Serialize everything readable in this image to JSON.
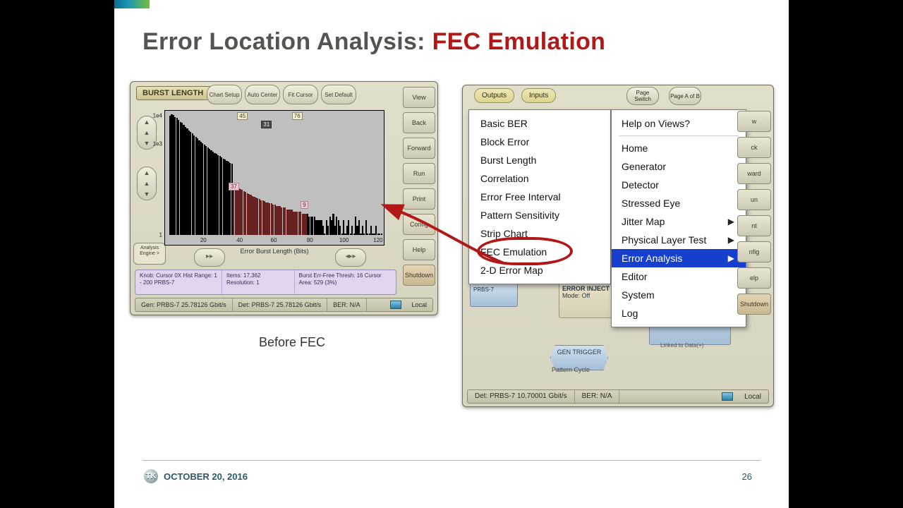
{
  "title": {
    "plain": "Error Location Analysis: ",
    "em": "FEC Emulation"
  },
  "footer": {
    "date": "OCTOBER 20, 2016",
    "page": "26",
    "logo": "TK"
  },
  "left_caption": "Before FEC",
  "chart_data": {
    "type": "bar",
    "title": "BURST LENGTH",
    "xlabel": "Error Burst Length (Bits)",
    "ylabel": "",
    "x_ticks": [
      20,
      40,
      60,
      80,
      100,
      120
    ],
    "y_scale": "log",
    "ylim": [
      1,
      10000
    ],
    "y_ticks": [
      "1",
      "1e3",
      "1e4"
    ],
    "highlight_range": [
      38,
      80
    ],
    "markers": [
      {
        "x": 45,
        "label": "45"
      },
      {
        "x": 76,
        "label": "76"
      },
      {
        "x_mid": 60,
        "label": "31"
      },
      {
        "x": 38,
        "y": 45,
        "label": "37",
        "style": "pink"
      },
      {
        "x": 80,
        "y": 6,
        "label": "9",
        "style": "pink"
      }
    ],
    "values": [
      8500,
      9400,
      8800,
      7600,
      7200,
      6200,
      5400,
      5000,
      4300,
      3700,
      3200,
      2800,
      2500,
      2200,
      1900,
      1700,
      1500,
      1300,
      1200,
      1050,
      950,
      850,
      760,
      690,
      620,
      560,
      510,
      470,
      430,
      400,
      360,
      330,
      300,
      280,
      260,
      240,
      220,
      45,
      40,
      37,
      34,
      32,
      30,
      27,
      26,
      24,
      22,
      21,
      19,
      18,
      17,
      16,
      15,
      14,
      14,
      13,
      12,
      12,
      11,
      11,
      10,
      10,
      9,
      9,
      9,
      8,
      8,
      8,
      7,
      7,
      7,
      7,
      6,
      6,
      6,
      6,
      6,
      5,
      5,
      5,
      5,
      4,
      4,
      4,
      4,
      3,
      3,
      3,
      3,
      2,
      1,
      3,
      2,
      4,
      3,
      5,
      2,
      4,
      3,
      2,
      1,
      3,
      1,
      2,
      3,
      1,
      2,
      1,
      4,
      2,
      3,
      1,
      2,
      1,
      3,
      1,
      1,
      2,
      1,
      1,
      2,
      1,
      1,
      1
    ]
  },
  "left_buttons": {
    "chart_setup": "Chart\nSetup",
    "auto_center": "Auto\nCenter",
    "fit_cursor": "Fit\nCursor",
    "set_default": "Set\nDefault"
  },
  "left_analysis_btn": "Analysis\nEngine >",
  "left_sidebar": [
    "View",
    "Back",
    "Forward",
    "Run",
    "Print",
    "Config",
    "Help",
    "Shutdown"
  ],
  "left_status": {
    "c1": "Knob: Cursor 0X\nHist Range: 1 - 200\nPRBS-7",
    "c2": "Items: 17,362\nResolution: 1",
    "c3": "Burst Err-Free Thresh: 16\nCursor Area: 529 (3%)"
  },
  "left_bottom": {
    "gen": "Gen: PRBS-7 25.78126 Gbit/s",
    "det": "Det: PRBS-7 25.78126 Gbit/s",
    "ber": "BER: N/A",
    "local": "Local"
  },
  "right_tabs": [
    "Outputs",
    "Inputs"
  ],
  "right_page_buttons": [
    "Page\nSwitch",
    "Page\nA of B"
  ],
  "menu_left": [
    "Basic BER",
    "Block Error",
    "Burst Length",
    "Correlation",
    "Error Free Interval",
    "Pattern Sensitivity",
    "Strip Chart",
    "FEC Emulation",
    "2-D Error Map"
  ],
  "menu_right_header": "Help on Views?",
  "menu_right": [
    {
      "label": "Home"
    },
    {
      "label": "Generator"
    },
    {
      "label": "Detector"
    },
    {
      "label": "Stressed Eye"
    },
    {
      "label": "Jitter Map",
      "sub": true
    },
    {
      "label": "Physical Layer Test",
      "sub": true
    },
    {
      "label": "Error Analysis",
      "sub": true,
      "selected": true
    },
    {
      "label": "Editor"
    },
    {
      "label": "System"
    },
    {
      "label": "Log"
    }
  ],
  "right_sidebar": [
    "w",
    "ck",
    "ward",
    "un",
    "nt",
    "nfig",
    "elp",
    "Shutdown"
  ],
  "right_blocks": {
    "prbs": "PRBS-7",
    "errinj_title": "ERROR INJECT",
    "errinj_sub": "Mode: Off",
    "gentrg": "GEN\nTRIGGER",
    "linked": "Linked to Data(+)",
    "pcycle": "Pattern Cycle"
  },
  "right_bottom": {
    "det": "Det: PRBS-7 10.70001 Gbit/s",
    "ber": "BER: N/A",
    "local": "Local"
  }
}
